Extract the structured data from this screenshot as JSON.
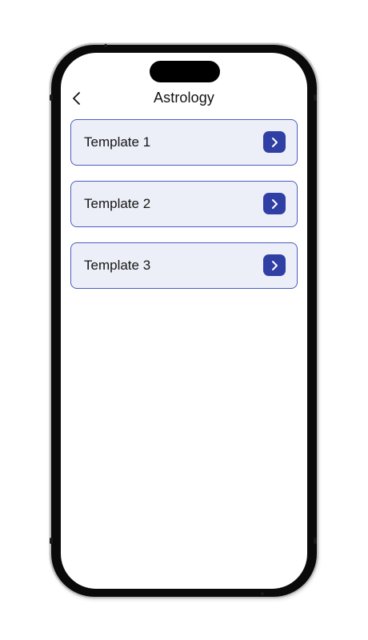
{
  "header": {
    "title": "Astrology",
    "back_icon": "chevron-left-icon"
  },
  "templates": [
    {
      "label": "Template 1",
      "icon": "chevron-right-icon"
    },
    {
      "label": "Template 2",
      "icon": "chevron-right-icon"
    },
    {
      "label": "Template 3",
      "icon": "chevron-right-icon"
    }
  ],
  "colors": {
    "card_background": "#edeff8",
    "card_border": "#4a5ac0",
    "accent_button": "#2f3fa3",
    "text": "#151515"
  }
}
